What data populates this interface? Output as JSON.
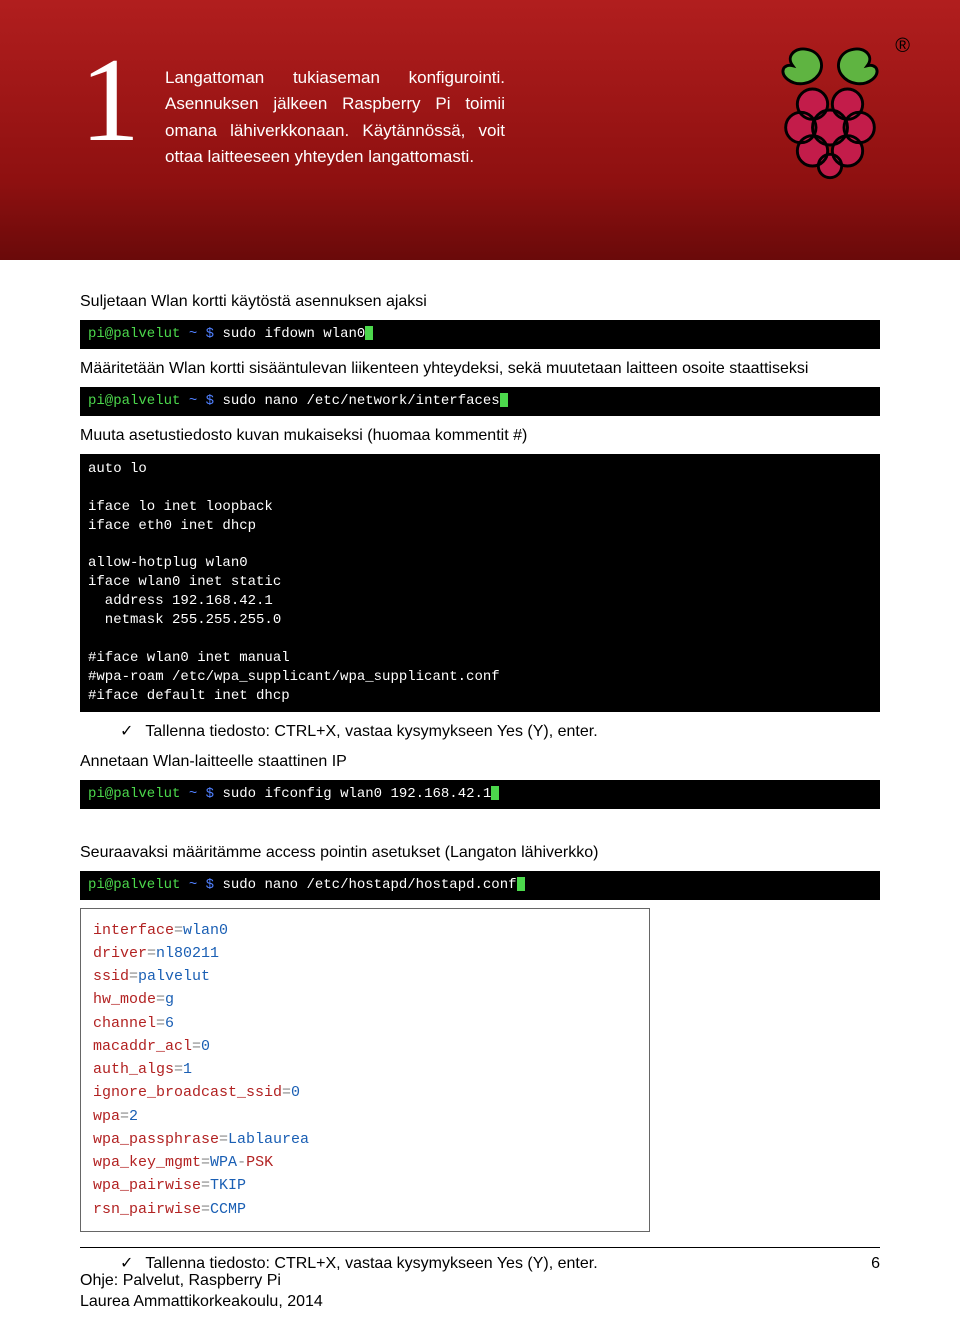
{
  "banner": {
    "step": "1",
    "text": "Langattoman tukiaseman konfigurointi. Asennuksen jälkeen Raspberry Pi toimii omana lähiverkkonaan. Käytännössä, voit ottaa laitteeseen yhteyden langattomasti.",
    "reg": "®"
  },
  "body": {
    "p1": "Suljetaan Wlan kortti käytöstä asennuksen ajaksi",
    "cmd1": {
      "prompt": "pi@palvelut",
      "tilde": "~ $",
      "text": "sudo ifdown wlan0"
    },
    "p2": "Määritetään Wlan kortti sisääntulevan liikenteen yhteydeksi, sekä muutetaan laitteen osoite staattiseksi",
    "cmd2": {
      "prompt": "pi@palvelut",
      "tilde": "~ $",
      "text": "sudo nano /etc/network/interfaces"
    },
    "p3": "Muuta asetustiedosto kuvan mukaiseksi (huomaa kommentit #)",
    "interfaces": "auto lo\n\niface lo inet loopback\niface eth0 inet dhcp\n\nallow-hotplug wlan0\niface wlan0 inet static\n  address 192.168.42.1\n  netmask 255.255.255.0\n\n#iface wlan0 inet manual\n#wpa-roam /etc/wpa_supplicant/wpa_supplicant.conf\n#iface default inet dhcp",
    "save1": "Tallenna tiedosto: CTRL+X, vastaa kysymykseen Yes (Y), enter.",
    "p4": "Annetaan Wlan-laitteelle staattinen IP",
    "cmd3": {
      "prompt": "pi@palvelut",
      "tilde": "~ $",
      "text": "sudo ifconfig wlan0 192.168.42.1"
    },
    "p5": "Seuraavaksi määritämme access pointin asetukset (Langaton lähiverkko)",
    "cmd4": {
      "prompt": "pi@palvelut",
      "tilde": "~ $",
      "text": "sudo nano /etc/hostapd/hostapd.conf"
    },
    "hostapd": [
      {
        "key": "interface",
        "val": "wlan0"
      },
      {
        "key": "driver",
        "val": "nl80211"
      },
      {
        "key": "ssid",
        "val": "palvelut"
      },
      {
        "key": "hw_mode",
        "val": "g"
      },
      {
        "key": "channel",
        "val": "6"
      },
      {
        "key": "macaddr_acl",
        "val": "0"
      },
      {
        "key": "auth_algs",
        "val": "1"
      },
      {
        "key": "ignore_broadcast_ssid",
        "val": "0"
      },
      {
        "key": "wpa",
        "val": "2"
      },
      {
        "key": "wpa_passphrase",
        "val": "Lablaurea"
      },
      {
        "key": "wpa_key_mgmt",
        "val": "WPA",
        "minus": "PSK"
      },
      {
        "key": "wpa_pairwise",
        "val": "TKIP"
      },
      {
        "key": "rsn_pairwise",
        "val": "CCMP"
      }
    ],
    "save2": "Tallenna tiedosto: CTRL+X, vastaa kysymykseen Yes (Y), enter."
  },
  "footer": {
    "page": "6",
    "line1": "Ohje: Palvelut, Raspberry Pi",
    "line2": "Laurea Ammattikorkeakoulu, 2014"
  }
}
